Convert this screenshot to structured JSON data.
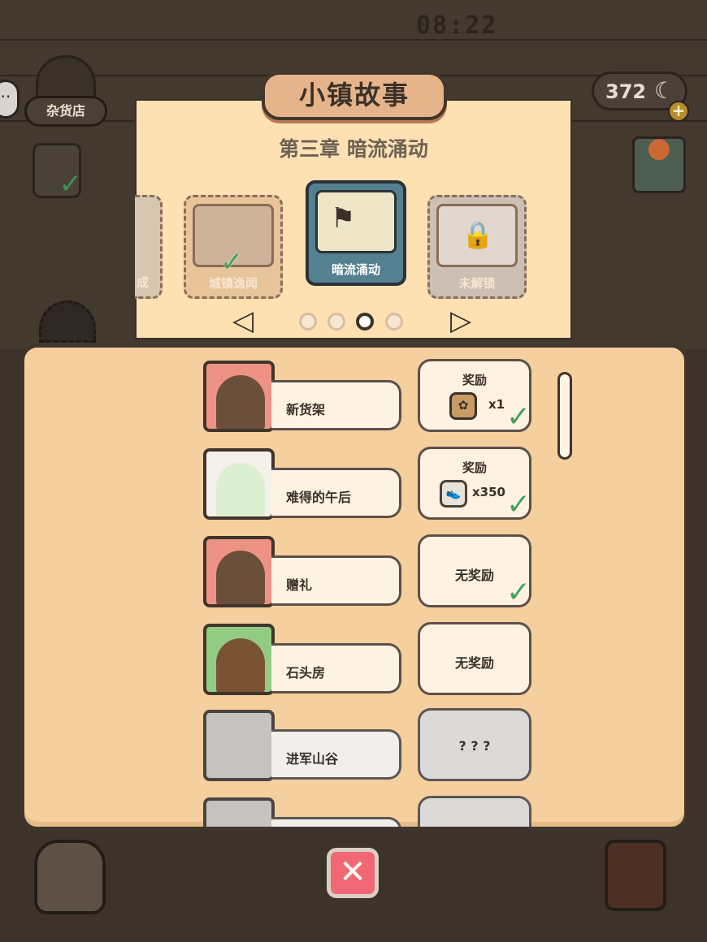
{
  "hud": {
    "clock": "08:22",
    "shop_label": "杂货店",
    "moon_count": "372",
    "chat_icon": "chat-bubble-icon",
    "moon_icon": "☾",
    "plus": "+"
  },
  "dialog": {
    "title": "小镇故事",
    "chapter": "第三章 暗流涌动",
    "cards": [
      {
        "label": "城镇逸闻",
        "state": "completed"
      },
      {
        "label": "暗流涌动",
        "state": "selected"
      },
      {
        "label": "未解锁",
        "state": "locked"
      }
    ],
    "partial_card_label": "成",
    "page_count": 4,
    "current_page": 3,
    "prev_arrow": "◁",
    "next_arrow": "▷"
  },
  "stories": [
    {
      "name": "新货架",
      "reward_title": "奖励",
      "reward_value": "x1",
      "reward_icon": "seed-bag-icon",
      "portrait": "hedgehog",
      "completed": true
    },
    {
      "name": "难得的午后",
      "reward_title": "奖励",
      "reward_value": "x350",
      "reward_icon": "shoe-icon",
      "portrait": "cat-wizard",
      "completed": true
    },
    {
      "name": "赠礼",
      "reward_title": "无奖励",
      "reward_value": "",
      "reward_icon": "",
      "portrait": "hedgehog",
      "completed": true
    },
    {
      "name": "石头房",
      "reward_title": "无奖励",
      "reward_value": "",
      "reward_icon": "",
      "portrait": "bear",
      "completed": false
    },
    {
      "name": "进军山谷",
      "reward_title": "? ? ?",
      "reward_value": "",
      "reward_icon": "",
      "portrait": "locked",
      "completed": false
    },
    {
      "name": "",
      "reward_title": "? ? ?",
      "reward_value": "",
      "reward_icon": "",
      "portrait": "locked",
      "completed": false
    }
  ],
  "bottom": {
    "close": "✕",
    "backpack_icon": "backpack-icon",
    "wallet_icon": "wallet-icon"
  },
  "colors": {
    "background": "#3d332a",
    "dialog": "#fde1b3",
    "panel": "#f6cf9f",
    "selected_card": "#55808f",
    "check": "#49a060",
    "close": "#f16874"
  }
}
